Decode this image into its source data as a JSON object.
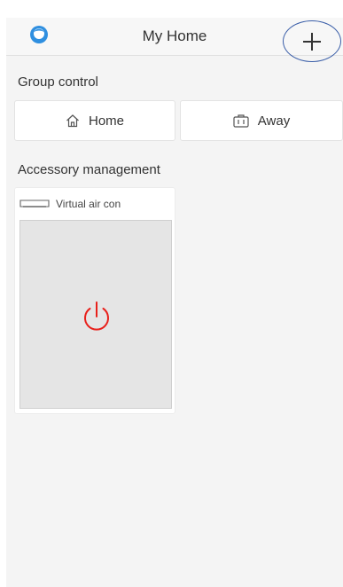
{
  "header": {
    "title": "My Home",
    "avatar_icon": "user-avatar-icon",
    "add_icon": "plus-icon"
  },
  "group_control": {
    "label": "Group control",
    "buttons": [
      {
        "label": "Home",
        "icon": "home-icon"
      },
      {
        "label": "Away",
        "icon": "briefcase-icon"
      }
    ]
  },
  "accessory_management": {
    "label": "Accessory management",
    "accessories": [
      {
        "name": "Virtual air con",
        "icon": "air-conditioner-icon",
        "power_icon": "power-icon",
        "power_color": "#e8201b"
      }
    ]
  },
  "colors": {
    "accent_circle": "#3a5ea8",
    "power": "#e8201b",
    "avatar": "#2f8fe0"
  }
}
